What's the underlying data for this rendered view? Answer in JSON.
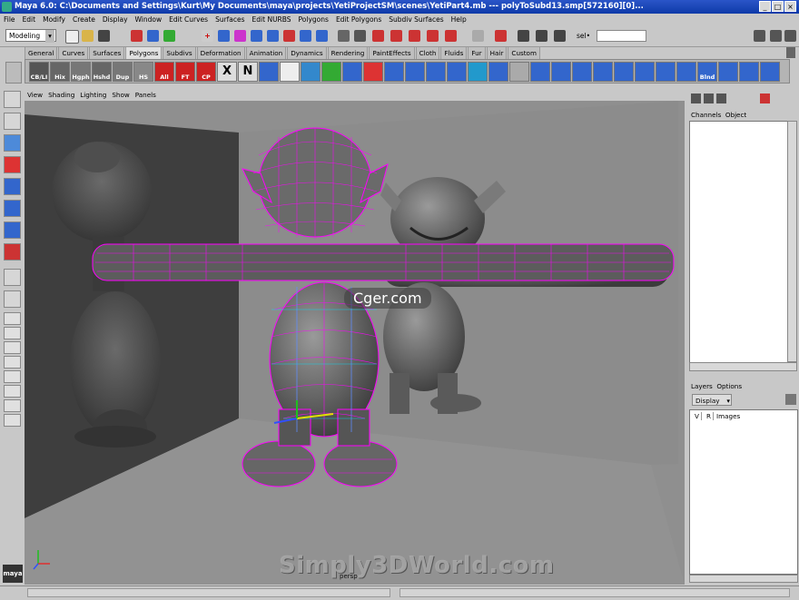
{
  "window": {
    "title": "Maya 6.0: C:\\Documents and Settings\\Kurt\\My Documents\\maya\\projects\\YetiProjectSM\\scenes\\YetiPart4.mb   ---   polyToSubd13.smp[572160][0]...",
    "minimize": "_",
    "maximize": "□",
    "close": "×"
  },
  "menubar": [
    "File",
    "Edit",
    "Modify",
    "Create",
    "Display",
    "Window",
    "Edit Curves",
    "Surfaces",
    "Edit NURBS",
    "Polygons",
    "Edit Polygons",
    "Subdiv Surfaces",
    "Help"
  ],
  "statusline": {
    "mode": "Modeling",
    "sel_label": "sel•"
  },
  "shelf_tabs": [
    "General",
    "Curves",
    "Surfaces",
    "Polygons",
    "Subdivs",
    "Deformation",
    "Animation",
    "Dynamics",
    "Rendering",
    "PaintEffects",
    "Cloth",
    "Fluids",
    "Fur",
    "Hair",
    "Custom"
  ],
  "active_shelf_tab": "Polygons",
  "shelf_buttons": [
    "CB/LI",
    "Hix",
    "Hgph",
    "Hshd",
    "Dup",
    "HS",
    "All",
    "FT",
    "CP",
    "X",
    "N",
    "",
    "",
    "",
    "",
    "",
    "",
    "",
    "",
    "",
    "",
    "",
    "",
    "",
    "",
    "",
    "",
    "",
    "",
    "",
    "",
    "",
    "Blnd",
    "",
    "",
    ""
  ],
  "panel_menu": [
    "View",
    "Shading",
    "Lighting",
    "Show",
    "Panels"
  ],
  "viewport": {
    "camera": "persp",
    "watermark_small": "Cger.com",
    "watermark_big": "Simply3DWorld.com"
  },
  "channel_box": {
    "tabs": [
      "Channels",
      "Object"
    ]
  },
  "layers": {
    "menu": [
      "Layers",
      "Options"
    ],
    "display_mode": "Display",
    "columns": [
      "V",
      "R"
    ],
    "layer_name": "Images"
  },
  "colors": {
    "title_bar": "#1a47b8",
    "wire": "#ff00ff",
    "cage": "#00e0ff",
    "viewport_bg": "#8f8f8f"
  }
}
